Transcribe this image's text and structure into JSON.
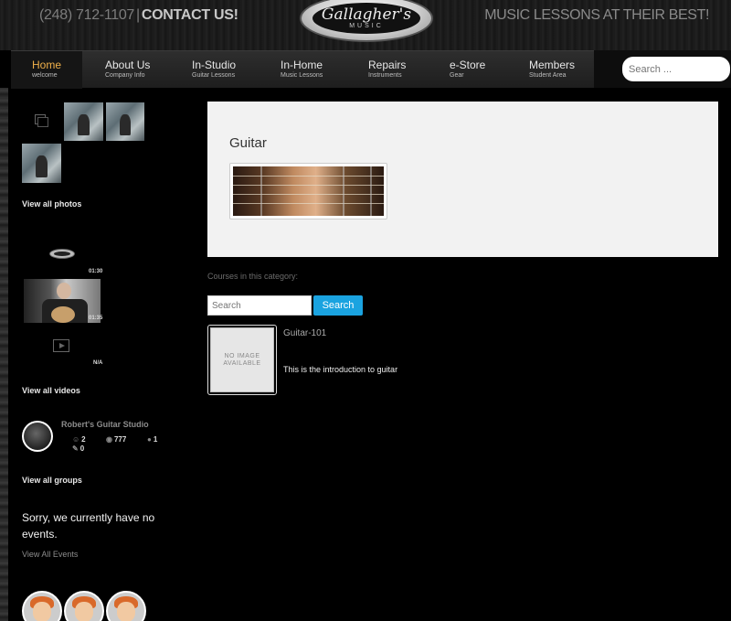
{
  "header": {
    "phone": "(248) 712-1107",
    "separator": "|",
    "contact": "CONTACT US!",
    "tagline": "MUSIC LESSONS AT THEIR BEST!",
    "logo_script": "Gallagher's",
    "logo_sub": "MUSIC"
  },
  "nav": {
    "items": [
      {
        "label": "Home",
        "sub": "welcome"
      },
      {
        "label": "About Us",
        "sub": "Company Info"
      },
      {
        "label": "In-Studio",
        "sub": "Guitar Lessons"
      },
      {
        "label": "In-Home",
        "sub": "Music Lessons"
      },
      {
        "label": "Repairs",
        "sub": "Instruments"
      },
      {
        "label": "e-Store",
        "sub": "Gear"
      },
      {
        "label": "Members",
        "sub": "Student Area"
      }
    ],
    "search_placeholder": "Search ..."
  },
  "sidebar": {
    "photos_link": "View all photos",
    "video_duration_1": "01:30",
    "video_duration_2": "01:35",
    "video_na": "N/A",
    "videos_link": "View all videos",
    "group": {
      "name": "Robert's Guitar Studio",
      "members": "2",
      "views": "777",
      "comments": "1",
      "edits": "0"
    },
    "groups_link": "View all groups",
    "events_message": "Sorry, we currently have no events.",
    "events_link": "View All Events"
  },
  "main": {
    "category_title": "Guitar",
    "courses_label": "Courses in this category:",
    "search_placeholder": "Search",
    "search_button": "Search",
    "course": {
      "no_image": "NO IMAGE AVAILABLE",
      "name": "Guitar-101",
      "description": "This is the introduction to guitar"
    }
  }
}
